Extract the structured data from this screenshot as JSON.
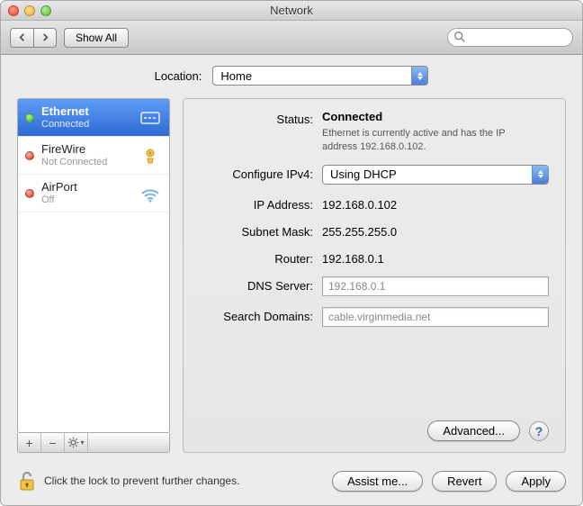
{
  "window": {
    "title": "Network"
  },
  "toolbar": {
    "show_all": "Show All",
    "search_placeholder": ""
  },
  "location": {
    "label": "Location:",
    "value": "Home"
  },
  "sidebar": {
    "items": [
      {
        "name": "Ethernet",
        "sub": "Connected",
        "status": "green",
        "icon": "ethernet"
      },
      {
        "name": "FireWire",
        "sub": "Not Connected",
        "status": "red",
        "icon": "firewire"
      },
      {
        "name": "AirPort",
        "sub": "Off",
        "status": "red",
        "icon": "wifi"
      }
    ]
  },
  "panel": {
    "status_label": "Status:",
    "status_value": "Connected",
    "status_desc": "Ethernet is currently active and has the IP address 192.168.0.102.",
    "configure_label": "Configure IPv4:",
    "configure_value": "Using DHCP",
    "ip_label": "IP Address:",
    "ip_value": "192.168.0.102",
    "mask_label": "Subnet Mask:",
    "mask_value": "255.255.255.0",
    "router_label": "Router:",
    "router_value": "192.168.0.1",
    "dns_label": "DNS Server:",
    "dns_value": "192.168.0.1",
    "search_label": "Search Domains:",
    "search_value": "cable.virginmedia.net",
    "advanced": "Advanced...",
    "help": "?"
  },
  "footer": {
    "lock_text": "Click the lock to prevent further changes.",
    "assist": "Assist me...",
    "revert": "Revert",
    "apply": "Apply"
  }
}
